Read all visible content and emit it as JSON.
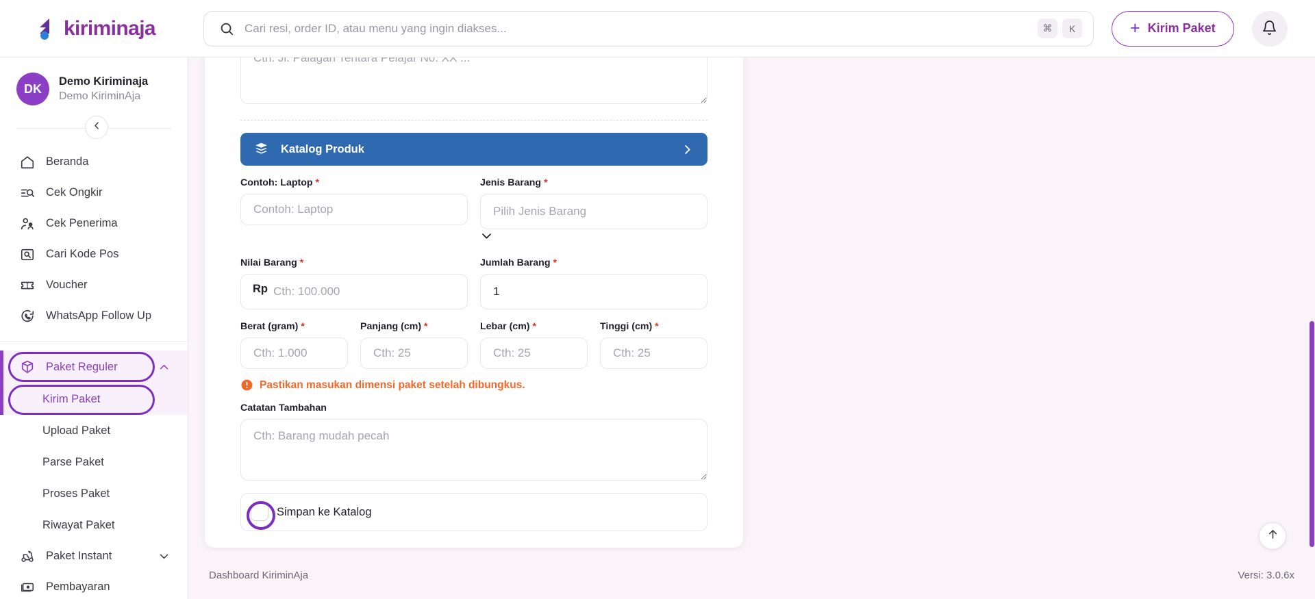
{
  "brand": {
    "name": "kiriminaja",
    "color": "#8b2fa0"
  },
  "topbar": {
    "search": {
      "placeholder": "Cari resi, order ID, atau menu yang ingin diakses...",
      "value": "",
      "icon": "search-icon",
      "shortcut_keys": [
        "⌘",
        "K"
      ]
    },
    "kirim_button": {
      "label": "Kirim Paket",
      "plus": "+",
      "icon": "plus-icon"
    },
    "notification_icon": "bell-icon"
  },
  "sidebar": {
    "profile": {
      "initials": "DK",
      "name": "Demo Kiriminaja",
      "subtitle": "Demo KiriminAja"
    },
    "collapse_icon": "chevron-left-icon",
    "items": [
      {
        "label": "Beranda",
        "icon": "home-icon"
      },
      {
        "label": "Cek Ongkir",
        "icon": "list-search-icon"
      },
      {
        "label": "Cek Penerima",
        "icon": "user-check-icon"
      },
      {
        "label": "Cari Kode Pos",
        "icon": "map-search-icon"
      },
      {
        "label": "Voucher",
        "icon": "ticket-icon"
      },
      {
        "label": "WhatsApp Follow Up",
        "icon": "whatsapp-icon"
      }
    ],
    "group": {
      "label": "Paket Reguler",
      "icon": "box-icon",
      "chevron": "chevron-up-icon",
      "highlighted": true,
      "children": [
        {
          "label": "Kirim Paket",
          "active": true,
          "highlighted": true
        },
        {
          "label": "Upload Paket",
          "active": false
        },
        {
          "label": "Parse Paket",
          "active": false
        },
        {
          "label": "Proses Paket",
          "active": false
        },
        {
          "label": "Riwayat Paket",
          "active": false
        }
      ]
    },
    "items_after": [
      {
        "label": "Paket Instant",
        "icon": "scooter-icon",
        "chevron": "chevron-down-icon"
      },
      {
        "label": "Pembayaran",
        "icon": "money-icon"
      }
    ]
  },
  "form": {
    "address_textarea": {
      "placeholder": "Cth: Jl. Palagan Tentara Pelajar No. XX ...",
      "value": ""
    },
    "katalog_bar": {
      "label": "Katalog Produk",
      "icon": "catalog-icon",
      "arrow_icon": "chevron-right-icon",
      "color": "#2f6ab0"
    },
    "fields": [
      {
        "label": "Contoh: Laptop",
        "required": true,
        "placeholder": "Contoh: Laptop",
        "value": "",
        "type": "text"
      },
      {
        "label": "Jenis Barang",
        "required": true,
        "placeholder": "Pilih Jenis Barang",
        "value": "",
        "type": "select"
      },
      {
        "label": "Nilai Barang",
        "required": true,
        "placeholder": "Cth: 100.000",
        "value": "",
        "prefix": "Rp",
        "type": "currency"
      },
      {
        "label": "Jumlah Barang",
        "required": true,
        "placeholder": "",
        "value": "1",
        "type": "number"
      },
      {
        "label": "Berat (gram)",
        "required": true,
        "placeholder": "Cth: 1.000",
        "value": "",
        "type": "number"
      },
      {
        "label": "Panjang (cm)",
        "required": true,
        "placeholder": "Cth: 25",
        "value": "",
        "type": "number"
      },
      {
        "label": "Lebar (cm)",
        "required": true,
        "placeholder": "Cth: 25",
        "value": "",
        "type": "number"
      },
      {
        "label": "Tinggi (cm)",
        "required": true,
        "placeholder": "Cth: 25",
        "value": "",
        "type": "number"
      }
    ],
    "warning": {
      "text": "Pastikan masukan dimensi paket setelah dibungkus.",
      "icon": "alert-circle-icon",
      "color": "#f2682a"
    },
    "note": {
      "label": "Catatan Tambahan",
      "placeholder": "Cth: Barang mudah pecah",
      "value": ""
    },
    "save_catalog": {
      "label": "Simpan ke Katalog",
      "checked": false,
      "highlighted": true
    }
  },
  "footer": {
    "left": "Dashboard KiriminAja",
    "right": "Versi: 3.0.6x",
    "scroll_top_icon": "arrow-up-icon"
  },
  "required_marker": "*"
}
